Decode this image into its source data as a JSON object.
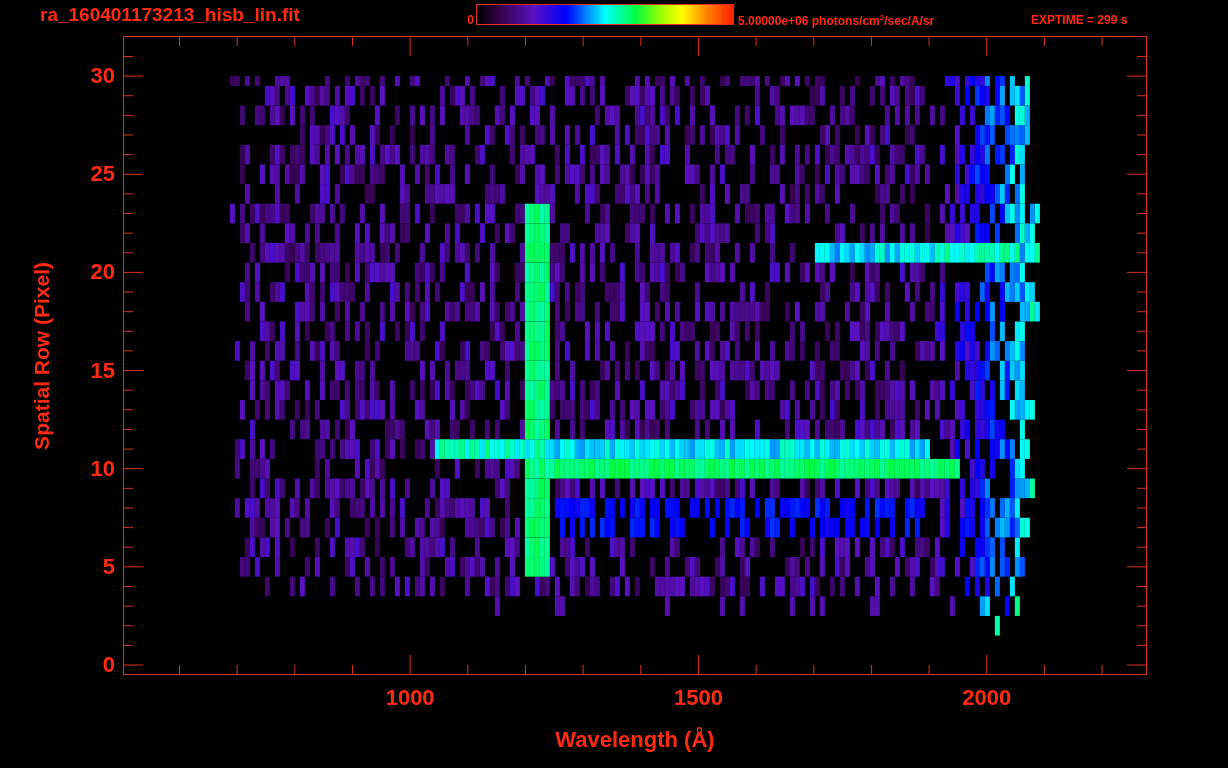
{
  "title": "ra_160401173213_hisb_lin.fit",
  "colorbar": {
    "min_label": "0",
    "max_label": "5.00000e+06 photons/cm$^{2}$/sec/A/sr"
  },
  "exposure": "EXPTIME = 299 s",
  "plot": {
    "xlabel": "Wavelength (Å)",
    "ylabel": "Spatial Row (Pixel)",
    "xtick_labels": [
      "1000",
      "1500",
      "2000"
    ],
    "ytick_labels": [
      "30",
      "25",
      "20",
      "15",
      "10",
      "5",
      "0"
    ]
  }
}
